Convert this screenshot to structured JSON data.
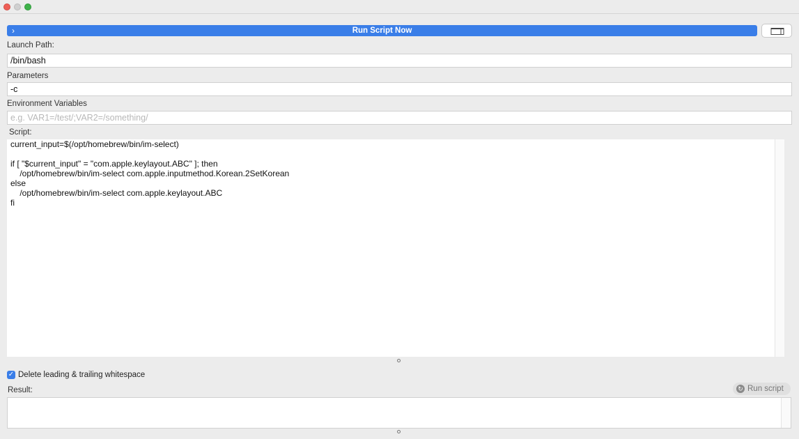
{
  "window": {
    "title": ""
  },
  "toolbar": {
    "run_now_label": "Run Script Now",
    "run_now_chevron": "›"
  },
  "fields": {
    "launch_path": {
      "label": "Launch Path:",
      "value": "/bin/bash"
    },
    "parameters": {
      "label": "Parameters",
      "value": "-c"
    },
    "env_vars": {
      "label": "Environment Variables",
      "placeholder": "e.g. VAR1=/test/;VAR2=/something/"
    }
  },
  "script": {
    "label": "Script:",
    "lines": [
      "current_input=$(/opt/homebrew/bin/im-select)",
      "",
      "if [ \"$current_input\" = \"com.apple.keylayout.ABC\" ]; then",
      "    /opt/homebrew/bin/im-select com.apple.inputmethod.Korean.2SetKorean",
      "else",
      "    /opt/homebrew/bin/im-select com.apple.keylayout.ABC",
      "fi"
    ]
  },
  "options": {
    "trim_whitespace_label": "Delete leading & trailing whitespace",
    "trim_whitespace_checked": true,
    "check_glyph": "✓"
  },
  "result": {
    "label": "Result:",
    "run_button_label": "Run script",
    "run_button_icon": "↻"
  },
  "colors": {
    "accent": "#3a7ee8",
    "window_bg": "#ececec"
  }
}
